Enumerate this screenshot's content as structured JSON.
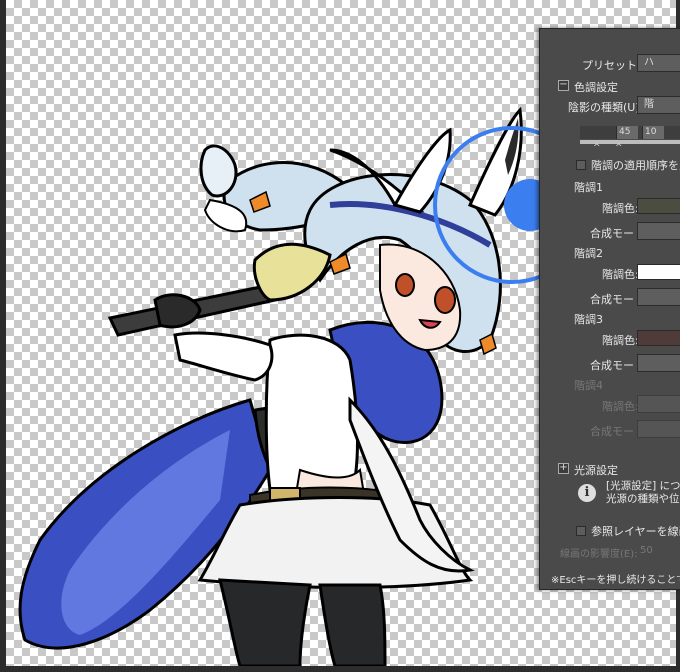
{
  "panel": {
    "preset_label": "プリセット(B):",
    "preset_value": "ハ",
    "tone_section_title": "色調設定",
    "shade_type_label": "陰影の種類(U):",
    "shade_type_value": "階",
    "slider_value_1": "45",
    "slider_value_2": "10",
    "reverse_order_label": "階調の適用順序を反転",
    "tones": [
      {
        "title": "階調1",
        "color_label": "階調色:",
        "color": "#4b4d41",
        "mode_label": "合成モード:",
        "enabled": true
      },
      {
        "title": "階調2",
        "color_label": "階調色:",
        "color": "#ffffff",
        "mode_label": "合成モード:",
        "enabled": true
      },
      {
        "title": "階調3",
        "color_label": "階調色:",
        "color": "#4f3b38",
        "mode_label": "合成モード:",
        "mode_value": "(",
        "enabled": true
      },
      {
        "title": "階調4",
        "color_label": "階調色:",
        "color": "#555555",
        "mode_label": "合成モード:",
        "enabled": false
      }
    ],
    "light_section_title": "光源設定",
    "info_line_1": "[光源設定] につい",
    "info_line_2": "光源の種類や位置",
    "ref_layer_label": "参照レイヤーを線画とす",
    "line_influence_label": "線画の影響度(E):",
    "line_influence_value": "50",
    "footer_note": "※Escキーを押し続けることでプレビ"
  },
  "colors": {
    "panel_bg": "#4a4a4a",
    "light_handle": "#3b7ef0",
    "cape": "#3a4fc2",
    "hair": "#cfe0ee"
  },
  "icons": {
    "collapse": "minus-toggle-icon",
    "expand": "plus-toggle-icon",
    "info": "info-icon",
    "light": "light-source-handle-icon"
  }
}
